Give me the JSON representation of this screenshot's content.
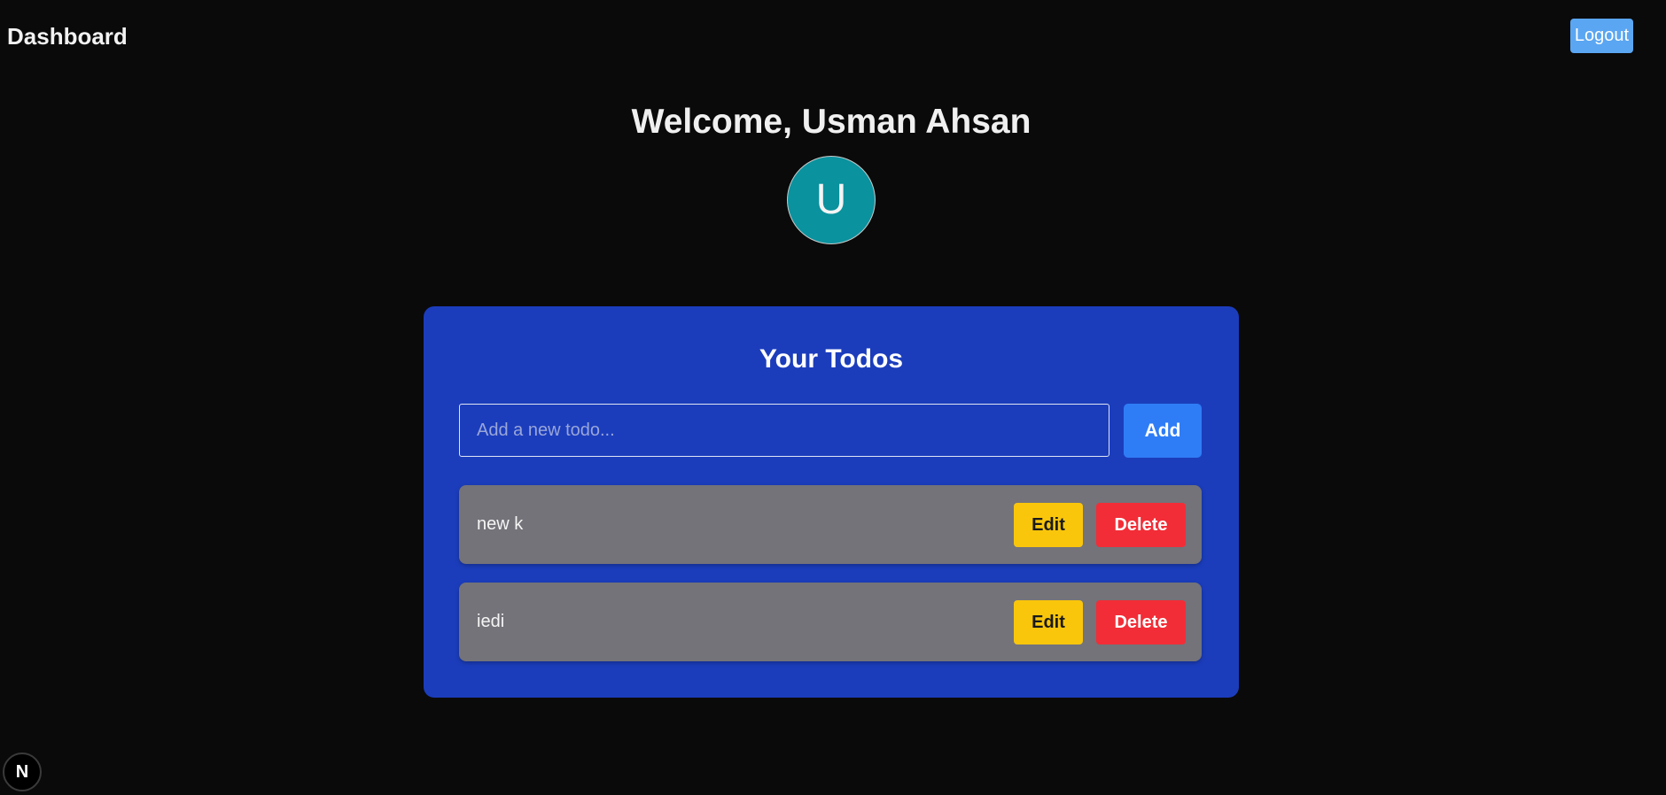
{
  "header": {
    "title": "Dashboard",
    "logout_label": "Logout"
  },
  "welcome": {
    "heading": "Welcome, Usman Ahsan",
    "avatar_initial": "U",
    "avatar_color": "#0a929e"
  },
  "todos": {
    "title": "Your Todos",
    "input_placeholder": "Add a new todo...",
    "input_value": "",
    "add_label": "Add",
    "edit_label": "Edit",
    "delete_label": "Delete",
    "items": [
      {
        "text": "new k"
      },
      {
        "text": "iedi"
      }
    ]
  },
  "dev_badge": {
    "label": "N",
    "icon": "nextjs-logo-icon"
  },
  "colors": {
    "background": "#0a0a0a",
    "card": "#1b3dbc",
    "add_button": "#2f7df6",
    "logout_button": "#5aa6f2",
    "row": "#737379",
    "edit_button": "#fac60c",
    "delete_button": "#f22d37"
  }
}
